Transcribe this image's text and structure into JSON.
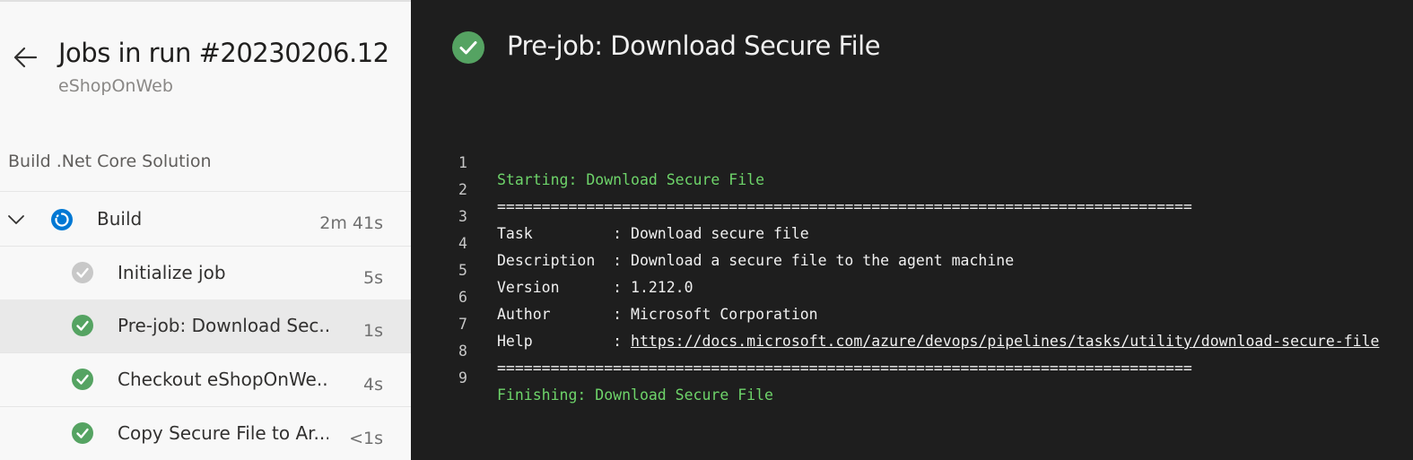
{
  "run": {
    "title": "Jobs in run #20230206.12",
    "project": "eShopOnWeb"
  },
  "stage": {
    "label": "Build .Net Core Solution"
  },
  "job": {
    "name": "Build",
    "duration": "2m 41s",
    "status": "running"
  },
  "steps": [
    {
      "name": "Initialize job",
      "duration": "5s",
      "status": "skipped-gray"
    },
    {
      "name": "Pre-job: Download Sec...",
      "duration": "1s",
      "status": "succeeded"
    },
    {
      "name": "Checkout eShopOnWe...",
      "duration": "4s",
      "status": "succeeded"
    },
    {
      "name": "Copy Secure File to Ar...",
      "duration": "<1s",
      "status": "succeeded"
    }
  ],
  "log": {
    "title": "Pre-job: Download Secure File",
    "lines": [
      {
        "num": "1",
        "text": "Starting: Download Secure File"
      },
      {
        "num": "2",
        "text": "=============================================================================="
      },
      {
        "num": "3",
        "text": "Task         : Download secure file"
      },
      {
        "num": "4",
        "text": "Description  : Download a secure file to the agent machine"
      },
      {
        "num": "5",
        "text": "Version      : 1.212.0"
      },
      {
        "num": "6",
        "text": "Author       : Microsoft Corporation"
      },
      {
        "num": "7",
        "prefix": "Help         : ",
        "link": "https://docs.microsoft.com/azure/devops/pipelines/tasks/utility/download-secure-file"
      },
      {
        "num": "8",
        "text": "=============================================================================="
      },
      {
        "num": "9",
        "text": "Finishing: Download Secure File"
      }
    ]
  },
  "colors": {
    "success": "#55a362",
    "running": "#0078d4",
    "gray_check": "#c8c8c8",
    "log_green": "#6ed46a",
    "log_bg": "#1e1e1e",
    "sidebar_bg": "#f8f8f8",
    "selected_row": "#e9e9e9"
  },
  "icons": {
    "back": "arrow-left-icon",
    "chevron": "chevron-down-icon",
    "running": "running-circle-icon",
    "success": "check-circle-icon"
  }
}
